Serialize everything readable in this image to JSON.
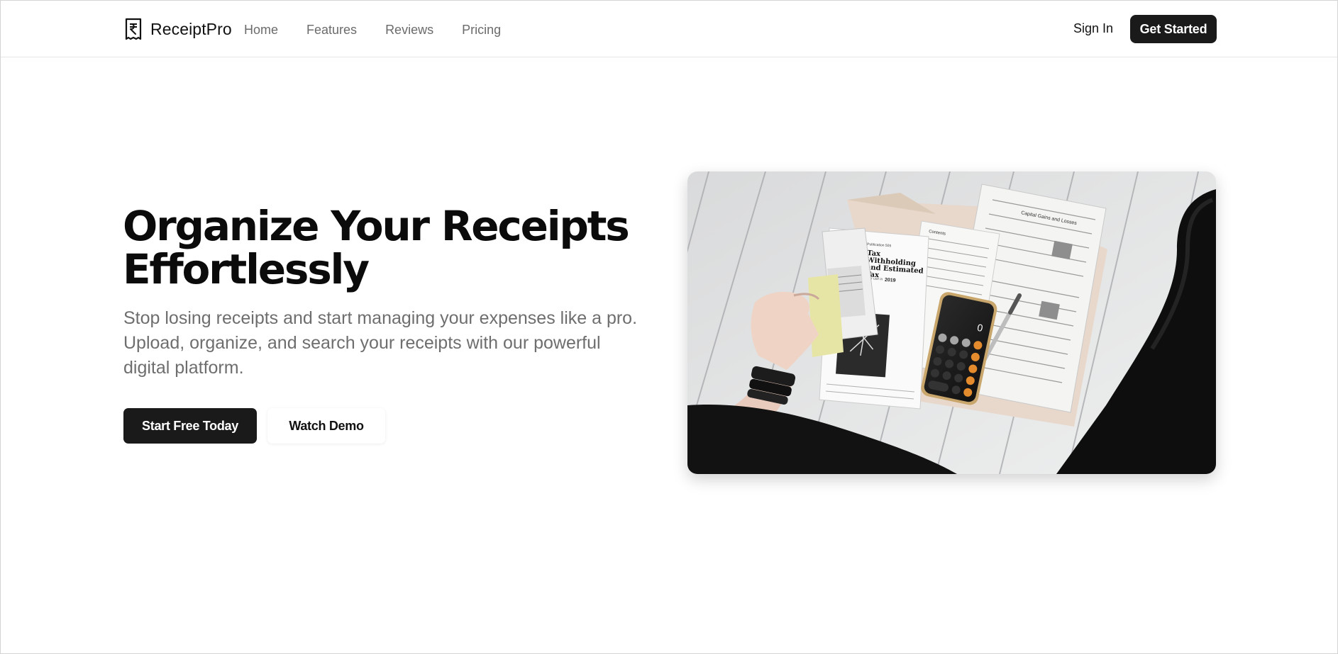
{
  "brand": {
    "name": "ReceiptPro",
    "icon": "receipt-rupee-icon"
  },
  "nav": {
    "links": [
      {
        "label": "Home"
      },
      {
        "label": "Features"
      },
      {
        "label": "Reviews"
      },
      {
        "label": "Pricing"
      }
    ],
    "sign_in": "Sign In",
    "get_started": "Get Started"
  },
  "hero": {
    "title_line1": "Organize Your Receipts",
    "title_line2": "Effortlessly",
    "subtitle": "Stop losing receipts and start managing your expenses like a pro. Upload, organize, and search your receipts with our powerful digital platform.",
    "primary_cta": "Start Free Today",
    "secondary_cta": "Watch Demo",
    "image": {
      "subject": "person-with-tax-forms-and-calculator-photo",
      "doc_texts": {
        "publication": "Publication 505",
        "title_line1": "Tax",
        "title_line2": "Withholding",
        "title_line3": "and Estimated",
        "title_line4": "Tax",
        "year_label": "For use in",
        "year": "2019",
        "contents": "Contents",
        "form_title": "Capital Gains and Losses"
      }
    }
  },
  "colors": {
    "primary_button": "#1a1a1a",
    "text_muted": "#6e6e6e",
    "nav_link": "#6b6b6b",
    "background": "#ffffff"
  }
}
